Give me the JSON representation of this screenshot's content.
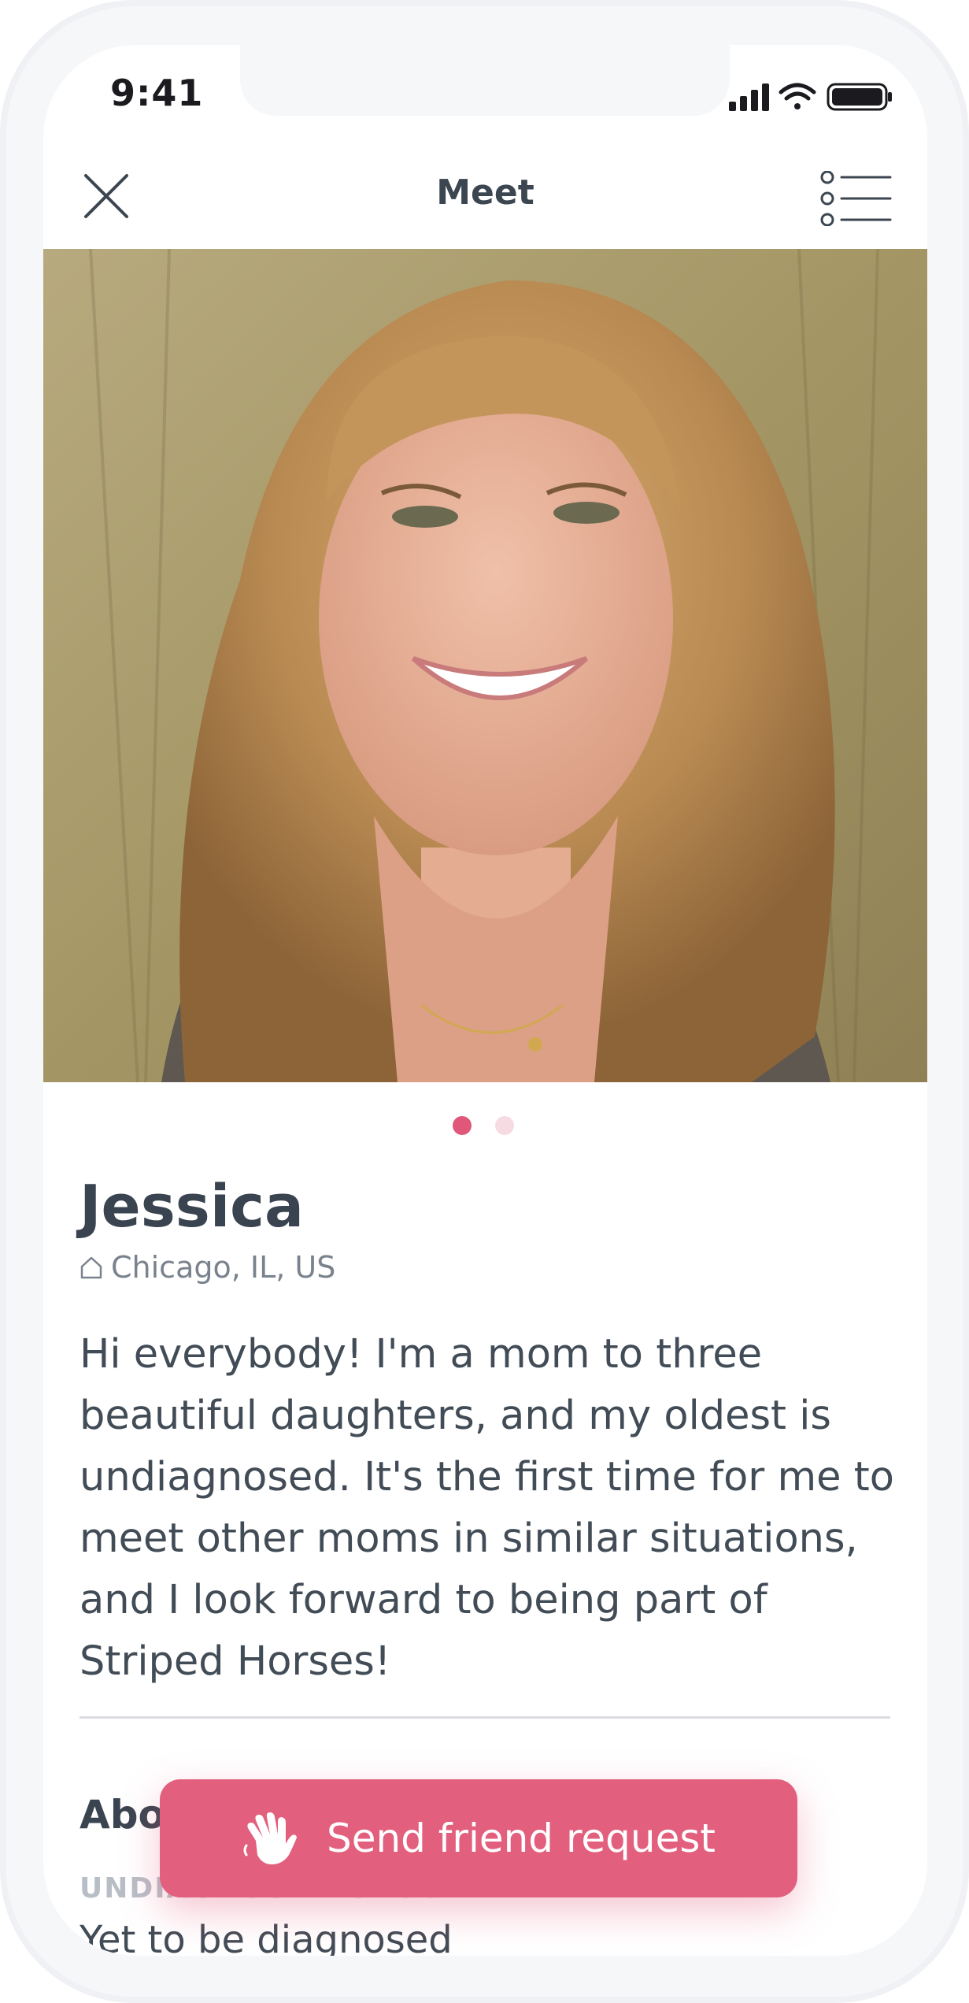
{
  "status_bar": {
    "time": "9:41"
  },
  "nav": {
    "title": "Meet"
  },
  "profile": {
    "name": "Jessica",
    "location": "Chicago, IL, US",
    "bio": "Hi everybody! I'm a mom to three beautiful daughters, and my oldest is undiagnosed. It's the first time for me to meet other moms in similar situations, and I look forward to being part of Striped Horses!",
    "photo_count": 2,
    "active_photo": 1
  },
  "about": {
    "heading": "Abo",
    "group_label": "UNDIAGNOSED GROUP",
    "group_value": "Yet to be diagnosed"
  },
  "cta": {
    "label": "Send friend request"
  },
  "colors": {
    "accent": "#e25f7e",
    "dot_active": "#e0577a",
    "dot_inactive": "#f7dbe3"
  }
}
